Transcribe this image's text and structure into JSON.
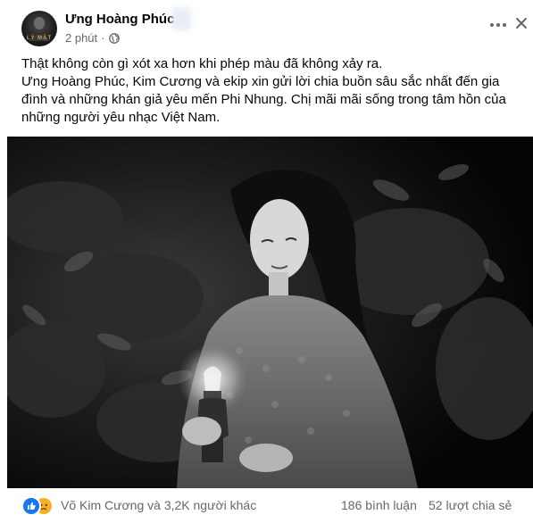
{
  "post": {
    "author": "Ưng Hoàng Phúc",
    "avatar_text": "LÝ MẶT",
    "time": "2 phút",
    "time_separator": "·",
    "privacy_icon": "globe-icon",
    "text_lines": [
      "Thật không còn gì xót xa hơn khi phép màu đã không xảy ra.",
      "Ưng Hoàng Phúc, Kim Cương và ekip xin gửi lời chia buồn sâu sắc nhất đến gia đình và những khán giả yêu mến Phi Nhung. Chị mãi mãi sống trong tâm hồn của những người yêu nhạc Việt Nam."
    ]
  },
  "footer": {
    "reaction_icons": [
      "like-icon",
      "sad-icon"
    ],
    "reactors": "Võ Kim Cương và 3,2K người khác",
    "comments": "186 bình luận",
    "shares": "52 lượt chia sẻ"
  },
  "colors": {
    "text": "#050505",
    "secondary": "#65676b",
    "like": "#1877f2",
    "sad": "#f7b125"
  }
}
